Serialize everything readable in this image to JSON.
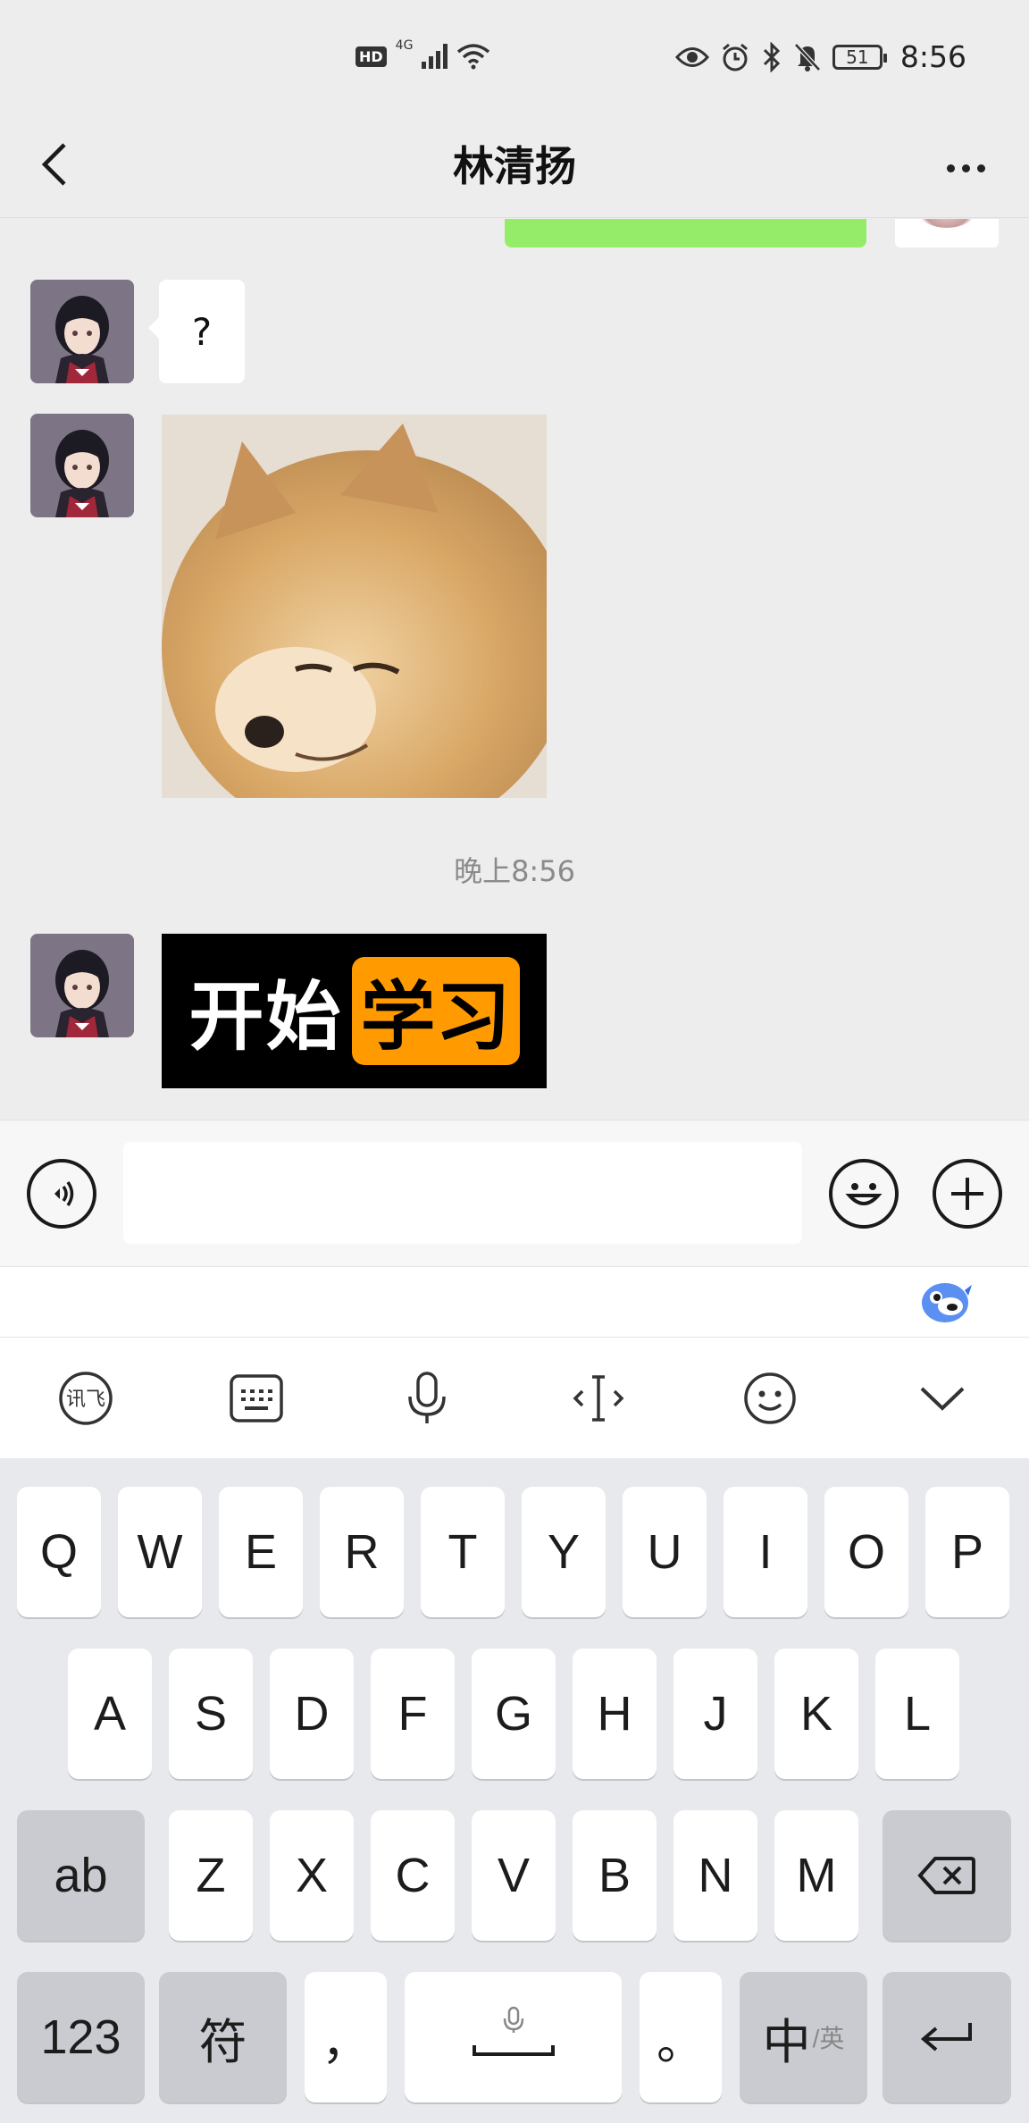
{
  "status_bar": {
    "hd": "HD",
    "network": "4G",
    "battery": "51",
    "time": "8:56"
  },
  "nav": {
    "title": "林清扬"
  },
  "messages": {
    "question_text": "?",
    "timestamp": "晚上8:56",
    "sticker_text_1": "开始",
    "sticker_text_2": "学习"
  },
  "input": {
    "value": "",
    "placeholder": ""
  },
  "keyboard": {
    "row1": [
      "Q",
      "W",
      "E",
      "R",
      "T",
      "Y",
      "U",
      "I",
      "O",
      "P"
    ],
    "row2": [
      "A",
      "S",
      "D",
      "F",
      "G",
      "H",
      "J",
      "K",
      "L"
    ],
    "row3": [
      "Z",
      "X",
      "C",
      "V",
      "B",
      "N",
      "M"
    ],
    "abc_key": "ab",
    "num_key": "123",
    "symbol_key": "符",
    "comma_key": "，",
    "period_key": "。",
    "lang_key_main": "中",
    "lang_key_sub": "/英"
  },
  "icons": {
    "toolbar": [
      "iflytek-logo-icon",
      "keyboard-icon",
      "microphone-icon",
      "cursor-icon",
      "emoji-icon",
      "collapse-chevron-icon"
    ]
  }
}
